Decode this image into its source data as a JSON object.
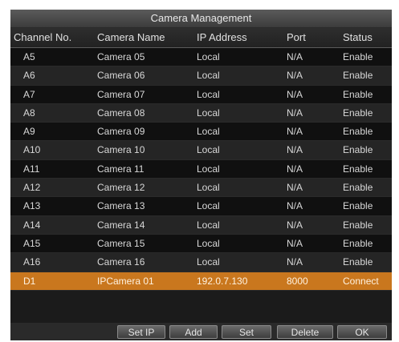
{
  "window": {
    "title": "Camera Management"
  },
  "table": {
    "columns": [
      "Channel No.",
      "Camera Name",
      "IP Address",
      "Port",
      "Status"
    ],
    "rows": [
      [
        "A5",
        "Camera 05",
        "Local",
        "N/A",
        "Enable"
      ],
      [
        "A6",
        "Camera 06",
        "Local",
        "N/A",
        "Enable"
      ],
      [
        "A7",
        "Camera 07",
        "Local",
        "N/A",
        "Enable"
      ],
      [
        "A8",
        "Camera 08",
        "Local",
        "N/A",
        "Enable"
      ],
      [
        "A9",
        "Camera 09",
        "Local",
        "N/A",
        "Enable"
      ],
      [
        "A10",
        "Camera 10",
        "Local",
        "N/A",
        "Enable"
      ],
      [
        "A11",
        "Camera 11",
        "Local",
        "N/A",
        "Enable"
      ],
      [
        "A12",
        "Camera 12",
        "Local",
        "N/A",
        "Enable"
      ],
      [
        "A13",
        "Camera 13",
        "Local",
        "N/A",
        "Enable"
      ],
      [
        "A14",
        "Camera 14",
        "Local",
        "N/A",
        "Enable"
      ],
      [
        "A15",
        "Camera 15",
        "Local",
        "N/A",
        "Enable"
      ],
      [
        "A16",
        "Camera 16",
        "Local",
        "N/A",
        "Enable"
      ],
      [
        "D1",
        "IPCamera 01",
        "192.0.7.130",
        "8000",
        "Connect"
      ]
    ],
    "selected_row": 12,
    "selected_color": "#c9771e"
  },
  "buttons": {
    "set_ip": "Set IP",
    "add": "Add",
    "set": "Set",
    "delete": "Delete",
    "ok": "OK"
  }
}
